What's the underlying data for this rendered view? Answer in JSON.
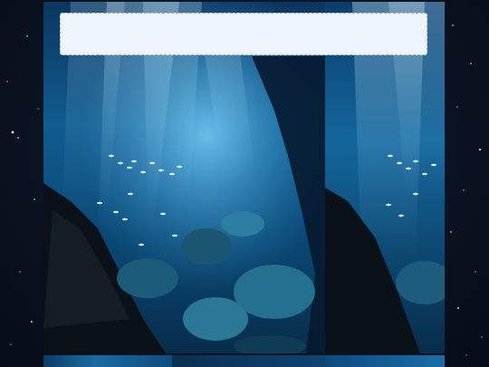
{
  "screen": {
    "background_color": "#0a1322",
    "accent_colors": [
      "#2a93d0",
      "#0b3d66",
      "#eef5fc"
    ]
  },
  "wallpaper": {
    "subject_icon": "underwater-cave-image",
    "star_icon": "star-icon"
  },
  "banner": {
    "text": ""
  }
}
